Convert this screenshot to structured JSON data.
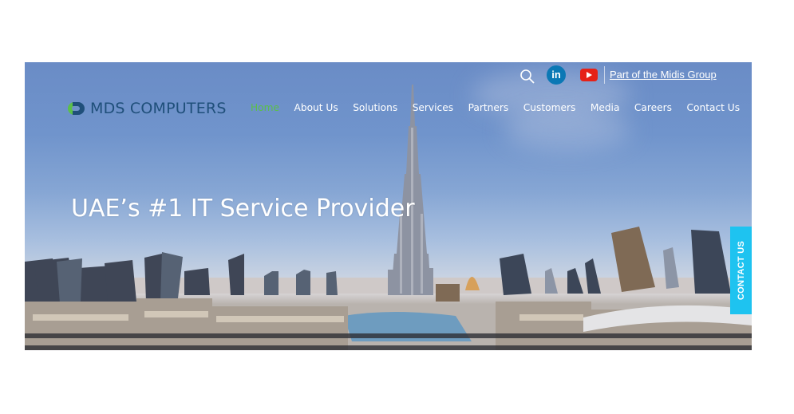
{
  "brand": {
    "name": "MDS COMPUTERS",
    "logo_icon": "mds-logo-icon",
    "colors": {
      "green": "#5bbf4a",
      "navy": "#1f4f7a"
    }
  },
  "topbar": {
    "search_icon": "search-icon",
    "linkedin_label": "in",
    "youtube_icon": "youtube-icon",
    "group_link": "Part of the Midis Group"
  },
  "nav": {
    "items": [
      {
        "label": "Home",
        "active": true
      },
      {
        "label": "About Us"
      },
      {
        "label": "Solutions"
      },
      {
        "label": "Services"
      },
      {
        "label": "Partners"
      },
      {
        "label": "Customers"
      },
      {
        "label": "Media"
      },
      {
        "label": "Careers"
      },
      {
        "label": "Contact Us"
      }
    ],
    "active_color": "#5bbf4a"
  },
  "hero": {
    "headline": "UAE’s #1 IT Service Provider",
    "background": "Dubai skyline with Burj Khalifa"
  },
  "contact_tab": {
    "label": "CONTACT US",
    "color": "#1ec3f0"
  }
}
